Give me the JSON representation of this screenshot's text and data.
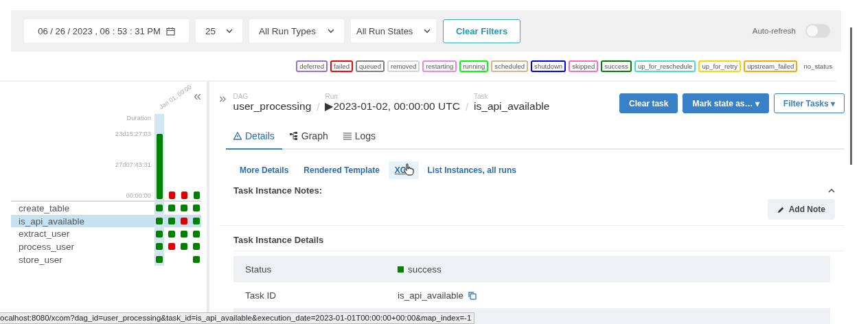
{
  "filters": {
    "date": "06 / 26 / 2023 ,  06 : 53 : 31  PM",
    "page_size": "25",
    "run_types": "All Run Types",
    "run_states": "All Run States",
    "clear_button": "Clear Filters",
    "auto_refresh": {
      "label": "Auto-refresh",
      "on": false
    }
  },
  "legend": [
    {
      "label": "deferred",
      "color": "#9370db"
    },
    {
      "label": "failed",
      "color": "#ff0000"
    },
    {
      "label": "queued",
      "color": "#808080"
    },
    {
      "label": "removed",
      "color": "#d3d3d3"
    },
    {
      "label": "restarting",
      "color": "#ee82ee"
    },
    {
      "label": "running",
      "color": "#00ff00"
    },
    {
      "label": "scheduled",
      "color": "#d2b48c"
    },
    {
      "label": "shutdown",
      "color": "#0000ff"
    },
    {
      "label": "skipped",
      "color": "#ff69b4"
    },
    {
      "label": "success",
      "color": "#008000"
    },
    {
      "label": "up_for_reschedule",
      "color": "#40e0d0"
    },
    {
      "label": "up_for_retry",
      "color": "#ffd700"
    },
    {
      "label": "upstream_failed",
      "color": "#ffa500"
    },
    {
      "label": "no_status"
    }
  ],
  "grid": {
    "collapse_icon": "«",
    "duration_label": "Duration",
    "run_label": "Jan 01, 00:00",
    "ticks": [
      "23d15:27:03",
      "27d07:43:31",
      "00:00:00"
    ],
    "runs": [
      {
        "color": "#008000",
        "kind": "long",
        "selected": true
      },
      {
        "color": "#e00000",
        "kind": "short",
        "selected": false
      },
      {
        "color": "#e00000",
        "kind": "short",
        "selected": false
      },
      {
        "color": "#008000",
        "kind": "short",
        "selected": false
      }
    ],
    "tasks": [
      {
        "name": "create_table",
        "selected": false,
        "cells": [
          {
            "kind": "square",
            "color": "#008000"
          },
          {
            "kind": "square",
            "color": "#008000"
          },
          {
            "kind": "square",
            "color": "#008000"
          },
          {
            "kind": "square",
            "color": "#008000"
          }
        ]
      },
      {
        "name": "is_api_available",
        "selected": true,
        "cells": [
          {
            "kind": "square",
            "color": "#008000"
          },
          {
            "kind": "square",
            "color": "#008000"
          },
          {
            "kind": "square",
            "color": "#e00000"
          },
          {
            "kind": "square",
            "color": "#008000"
          }
        ]
      },
      {
        "name": "extract_user",
        "selected": false,
        "cells": [
          {
            "kind": "square",
            "color": "#008000"
          },
          {
            "kind": "square",
            "color": "#008000"
          },
          {
            "kind": "square",
            "color": "#008000"
          },
          {
            "kind": "square",
            "color": "#008000"
          }
        ]
      },
      {
        "name": "process_user",
        "selected": false,
        "cells": [
          {
            "kind": "square",
            "color": "#008000"
          },
          {
            "kind": "square",
            "color": "#e00000"
          },
          {
            "kind": "square",
            "color": "#008000"
          },
          {
            "kind": "square",
            "color": "#008000"
          }
        ]
      },
      {
        "name": "store_user",
        "selected": false,
        "cells": [
          {
            "kind": "square",
            "color": "#008000"
          },
          {
            "kind": "empty"
          },
          {
            "kind": "empty"
          },
          {
            "kind": "square",
            "color": "#008000"
          }
        ]
      }
    ]
  },
  "detail": {
    "expand_icon": "»",
    "separator": "/",
    "breadcrumbs": [
      {
        "caption": "DAG",
        "value": "user_processing"
      },
      {
        "caption": "Run",
        "value": "▶2023-01-02, 00:00:00 UTC"
      },
      {
        "caption": "Task",
        "value": "is_api_available"
      }
    ],
    "actions": [
      {
        "label": "Clear task",
        "kind": "primary"
      },
      {
        "label": "Mark state as… ▾",
        "kind": "primary"
      },
      {
        "label": "Filter Tasks ▾",
        "kind": "outline"
      }
    ],
    "tabs": [
      {
        "label": "Details",
        "selected": true
      },
      {
        "label": "Graph",
        "selected": false
      },
      {
        "label": "Logs",
        "selected": false
      }
    ],
    "subtabs": [
      {
        "label": "More Details",
        "hovered": false
      },
      {
        "label": "Rendered Template",
        "hovered": false
      },
      {
        "label": "XC",
        "hovered": true
      },
      {
        "label": "List Instances, all runs",
        "hovered": false
      }
    ],
    "notes": {
      "title": "Task Instance Notes:",
      "expanded": true,
      "button": "Add Note"
    },
    "details_title": "Task Instance Details",
    "rows": [
      {
        "kind": "status",
        "label": "Status",
        "value": "success",
        "color": "#008000"
      },
      {
        "kind": "copy",
        "label": "Task ID",
        "value": "is_api_available"
      },
      {
        "kind": "hidden"
      }
    ]
  },
  "status_bar": "ocalhost:8080/xcom?dag_id=user_processing&task_id=is_api_available&execution_date=2023-01-01T00:00:00+00:00&map_index=-1"
}
